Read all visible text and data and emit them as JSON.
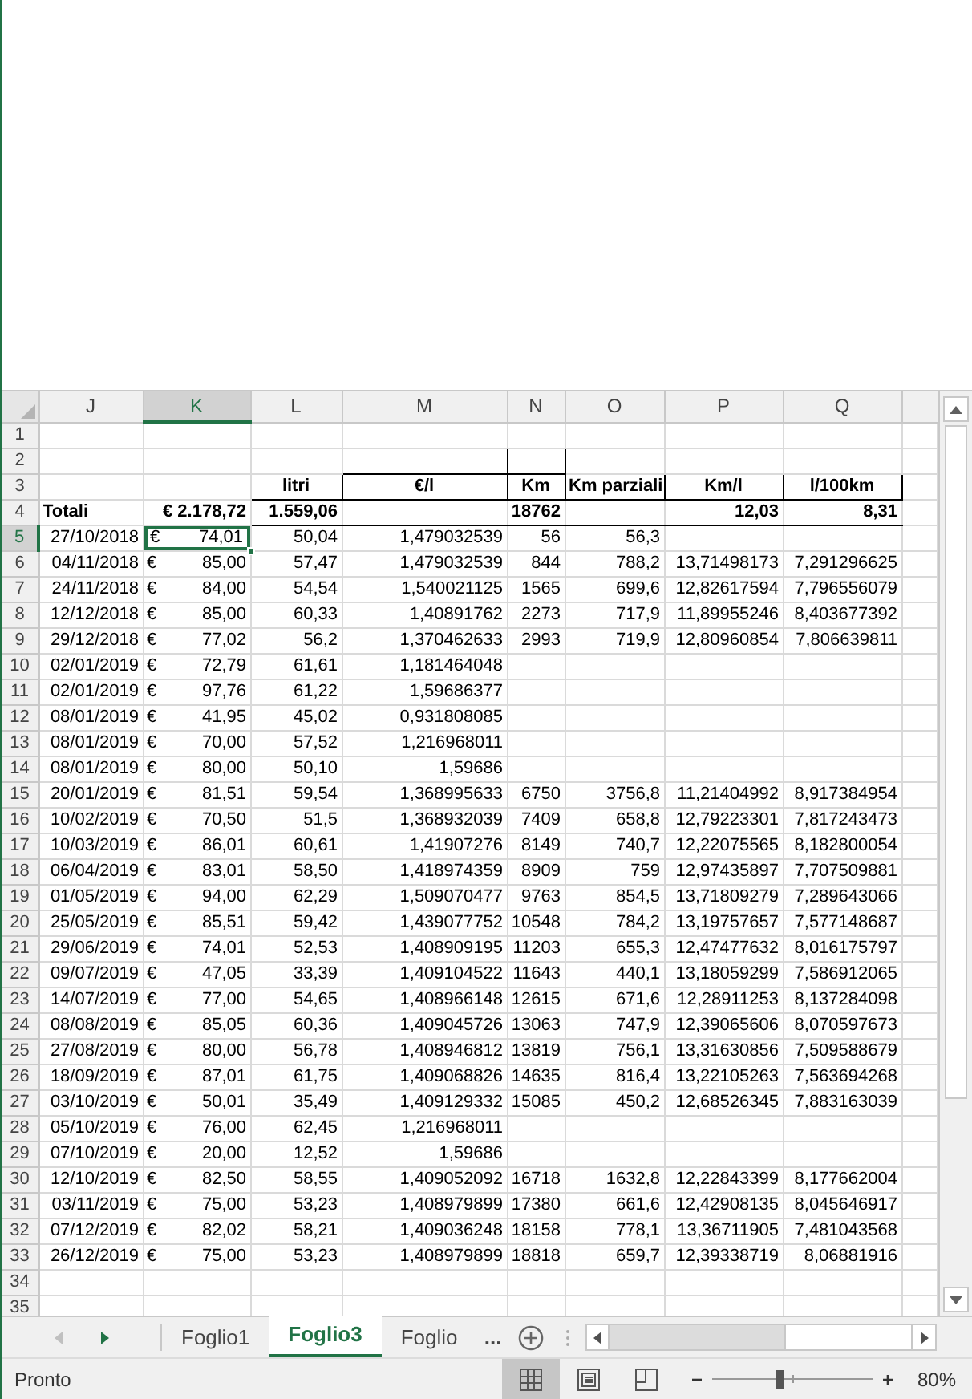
{
  "columns": [
    {
      "letter": "J",
      "selected": false
    },
    {
      "letter": "K",
      "selected": true
    },
    {
      "letter": "L",
      "selected": false
    },
    {
      "letter": "M",
      "selected": false
    },
    {
      "letter": "N",
      "selected": false
    },
    {
      "letter": "O",
      "selected": false
    },
    {
      "letter": "P",
      "selected": false
    },
    {
      "letter": "Q",
      "selected": false
    }
  ],
  "rows": [
    {
      "number": "1",
      "kind": "plain",
      "selected": false
    },
    {
      "number": "2",
      "kind": "box",
      "selected": false
    },
    {
      "number": "3",
      "kind": "header",
      "selected": false,
      "labels": [
        "litri",
        "€/l",
        "Km",
        "Km parziali",
        "Km/l",
        "l/100km"
      ]
    },
    {
      "number": "4",
      "kind": "totals",
      "selected": false,
      "label": "Totali",
      "symbol": "€",
      "amount": "2.178,72",
      "litri": "1.559,06",
      "km": "18762",
      "kml": "12,03",
      "l100km": "8,31"
    },
    {
      "number": "5",
      "kind": "data",
      "selected": true,
      "date": "27/10/2018",
      "symbol": "€",
      "amount": "74,01",
      "litri": "50,04",
      "eur_l": "1,479032539",
      "km": "56",
      "km_parz": "56,3"
    },
    {
      "number": "6",
      "kind": "data",
      "selected": false,
      "date": "04/11/2018",
      "symbol": "€",
      "amount": "85,00",
      "litri": "57,47",
      "eur_l": "1,479032539",
      "km": "844",
      "km_parz": "788,2",
      "kml": "13,71498173",
      "l100km": "7,291296625"
    },
    {
      "number": "7",
      "kind": "data",
      "selected": false,
      "date": "24/11/2018",
      "symbol": "€",
      "amount": "84,00",
      "litri": "54,54",
      "eur_l": "1,540021125",
      "km": "1565",
      "km_parz": "699,6",
      "kml": "12,82617594",
      "l100km": "7,796556079"
    },
    {
      "number": "8",
      "kind": "data",
      "selected": false,
      "date": "12/12/2018",
      "symbol": "€",
      "amount": "85,00",
      "litri": "60,33",
      "eur_l": "1,40891762",
      "km": "2273",
      "km_parz": "717,9",
      "kml": "11,89955246",
      "l100km": "8,403677392"
    },
    {
      "number": "9",
      "kind": "data",
      "selected": false,
      "date": "29/12/2018",
      "symbol": "€",
      "amount": "77,02",
      "litri": "56,2",
      "eur_l": "1,370462633",
      "km": "2993",
      "km_parz": "719,9",
      "kml": "12,80960854",
      "l100km": "7,806639811"
    },
    {
      "number": "10",
      "kind": "data",
      "selected": false,
      "date": "02/01/2019",
      "symbol": "€",
      "amount": "72,79",
      "litri": "61,61",
      "eur_l": "1,181464048"
    },
    {
      "number": "11",
      "kind": "data",
      "selected": false,
      "date": "02/01/2019",
      "symbol": "€",
      "amount": "97,76",
      "litri": "61,22",
      "eur_l": "1,59686377"
    },
    {
      "number": "12",
      "kind": "data",
      "selected": false,
      "date": "08/01/2019",
      "symbol": "€",
      "amount": "41,95",
      "litri": "45,02",
      "eur_l": "0,931808085"
    },
    {
      "number": "13",
      "kind": "data",
      "selected": false,
      "date": "08/01/2019",
      "symbol": "€",
      "amount": "70,00",
      "litri": "57,52",
      "eur_l": "1,216968011"
    },
    {
      "number": "14",
      "kind": "data",
      "selected": false,
      "date": "08/01/2019",
      "symbol": "€",
      "amount": "80,00",
      "litri": "50,10",
      "eur_l": "1,59686"
    },
    {
      "number": "15",
      "kind": "data",
      "selected": false,
      "date": "20/01/2019",
      "symbol": "€",
      "amount": "81,51",
      "litri": "59,54",
      "eur_l": "1,368995633",
      "km": "6750",
      "km_parz": "3756,8",
      "kml": "11,21404992",
      "l100km": "8,917384954"
    },
    {
      "number": "16",
      "kind": "data",
      "selected": false,
      "date": "10/02/2019",
      "symbol": "€",
      "amount": "70,50",
      "litri": "51,5",
      "eur_l": "1,368932039",
      "km": "7409",
      "km_parz": "658,8",
      "kml": "12,79223301",
      "l100km": "7,817243473"
    },
    {
      "number": "17",
      "kind": "data",
      "selected": false,
      "date": "10/03/2019",
      "symbol": "€",
      "amount": "86,01",
      "litri": "60,61",
      "eur_l": "1,41907276",
      "km": "8149",
      "km_parz": "740,7",
      "kml": "12,22075565",
      "l100km": "8,182800054"
    },
    {
      "number": "18",
      "kind": "data",
      "selected": false,
      "date": "06/04/2019",
      "symbol": "€",
      "amount": "83,01",
      "litri": "58,50",
      "eur_l": "1,418974359",
      "km": "8909",
      "km_parz": "759",
      "kml": "12,97435897",
      "l100km": "7,707509881"
    },
    {
      "number": "19",
      "kind": "data",
      "selected": false,
      "date": "01/05/2019",
      "symbol": "€",
      "amount": "94,00",
      "litri": "62,29",
      "eur_l": "1,509070477",
      "km": "9763",
      "km_parz": "854,5",
      "kml": "13,71809279",
      "l100km": "7,289643066"
    },
    {
      "number": "20",
      "kind": "data",
      "selected": false,
      "date": "25/05/2019",
      "symbol": "€",
      "amount": "85,51",
      "litri": "59,42",
      "eur_l": "1,439077752",
      "km": "10548",
      "km_parz": "784,2",
      "kml": "13,19757657",
      "l100km": "7,577148687"
    },
    {
      "number": "21",
      "kind": "data",
      "selected": false,
      "date": "29/06/2019",
      "symbol": "€",
      "amount": "74,01",
      "litri": "52,53",
      "eur_l": "1,408909195",
      "km": "11203",
      "km_parz": "655,3",
      "kml": "12,47477632",
      "l100km": "8,016175797"
    },
    {
      "number": "22",
      "kind": "data",
      "selected": false,
      "date": "09/07/2019",
      "symbol": "€",
      "amount": "47,05",
      "litri": "33,39",
      "eur_l": "1,409104522",
      "km": "11643",
      "km_parz": "440,1",
      "kml": "13,18059299",
      "l100km": "7,586912065"
    },
    {
      "number": "23",
      "kind": "data",
      "selected": false,
      "date": "14/07/2019",
      "symbol": "€",
      "amount": "77,00",
      "litri": "54,65",
      "eur_l": "1,408966148",
      "km": "12615",
      "km_parz": "671,6",
      "kml": "12,28911253",
      "l100km": "8,137284098"
    },
    {
      "number": "24",
      "kind": "data",
      "selected": false,
      "date": "08/08/2019",
      "symbol": "€",
      "amount": "85,05",
      "litri": "60,36",
      "eur_l": "1,409045726",
      "km": "13063",
      "km_parz": "747,9",
      "kml": "12,39065606",
      "l100km": "8,070597673"
    },
    {
      "number": "25",
      "kind": "data",
      "selected": false,
      "date": "27/08/2019",
      "symbol": "€",
      "amount": "80,00",
      "litri": "56,78",
      "eur_l": "1,408946812",
      "km": "13819",
      "km_parz": "756,1",
      "kml": "13,31630856",
      "l100km": "7,509588679"
    },
    {
      "number": "26",
      "kind": "data",
      "selected": false,
      "date": "18/09/2019",
      "symbol": "€",
      "amount": "87,01",
      "litri": "61,75",
      "eur_l": "1,409068826",
      "km": "14635",
      "km_parz": "816,4",
      "kml": "13,22105263",
      "l100km": "7,563694268"
    },
    {
      "number": "27",
      "kind": "data",
      "selected": false,
      "date": "03/10/2019",
      "symbol": "€",
      "amount": "50,01",
      "litri": "35,49",
      "eur_l": "1,409129332",
      "km": "15085",
      "km_parz": "450,2",
      "kml": "12,68526345",
      "l100km": "7,883163039"
    },
    {
      "number": "28",
      "kind": "data",
      "selected": false,
      "date": "05/10/2019",
      "symbol": "€",
      "amount": "76,00",
      "litri": "62,45",
      "eur_l": "1,216968011"
    },
    {
      "number": "29",
      "kind": "data",
      "selected": false,
      "date": "07/10/2019",
      "symbol": "€",
      "amount": "20,00",
      "litri": "12,52",
      "eur_l": "1,59686"
    },
    {
      "number": "30",
      "kind": "data",
      "selected": false,
      "date": "12/10/2019",
      "symbol": "€",
      "amount": "82,50",
      "litri": "58,55",
      "eur_l": "1,409052092",
      "km": "16718",
      "km_parz": "1632,8",
      "kml": "12,22843399",
      "l100km": "8,177662004"
    },
    {
      "number": "31",
      "kind": "data",
      "selected": false,
      "date": "03/11/2019",
      "symbol": "€",
      "amount": "75,00",
      "litri": "53,23",
      "eur_l": "1,408979899",
      "km": "17380",
      "km_parz": "661,6",
      "kml": "12,42908135",
      "l100km": "8,045646917"
    },
    {
      "number": "32",
      "kind": "data",
      "selected": false,
      "date": "07/12/2019",
      "symbol": "€",
      "amount": "82,02",
      "litri": "58,21",
      "eur_l": "1,409036248",
      "km": "18158",
      "km_parz": "778,1",
      "kml": "13,36711905",
      "l100km": "7,481043568"
    },
    {
      "number": "33",
      "kind": "data",
      "selected": false,
      "date": "26/12/2019",
      "symbol": "€",
      "amount": "75,00",
      "litri": "53,23",
      "eur_l": "1,408979899",
      "km": "18818",
      "km_parz": "659,7",
      "kml": "12,39338719",
      "l100km": "8,06881916"
    },
    {
      "number": "34",
      "kind": "plain",
      "selected": false
    },
    {
      "number": "35",
      "kind": "plain",
      "selected": false
    }
  ],
  "sheet_tabs": [
    {
      "label": "Foglio1",
      "selected": false
    },
    {
      "label": "Foglio3",
      "selected": true
    },
    {
      "label": "Foglio",
      "selected": false
    }
  ],
  "more_tabs": "...",
  "status_bar": {
    "text": "Pronto",
    "views": [
      {
        "kind": "normal",
        "selected": true
      },
      {
        "kind": "page_layout",
        "selected": false
      },
      {
        "kind": "page_break",
        "selected": false
      }
    ],
    "zoom_out": "−",
    "zoom": {
      "level": 0.42
    },
    "zoom_in": "+",
    "zoom_value": "80%"
  }
}
